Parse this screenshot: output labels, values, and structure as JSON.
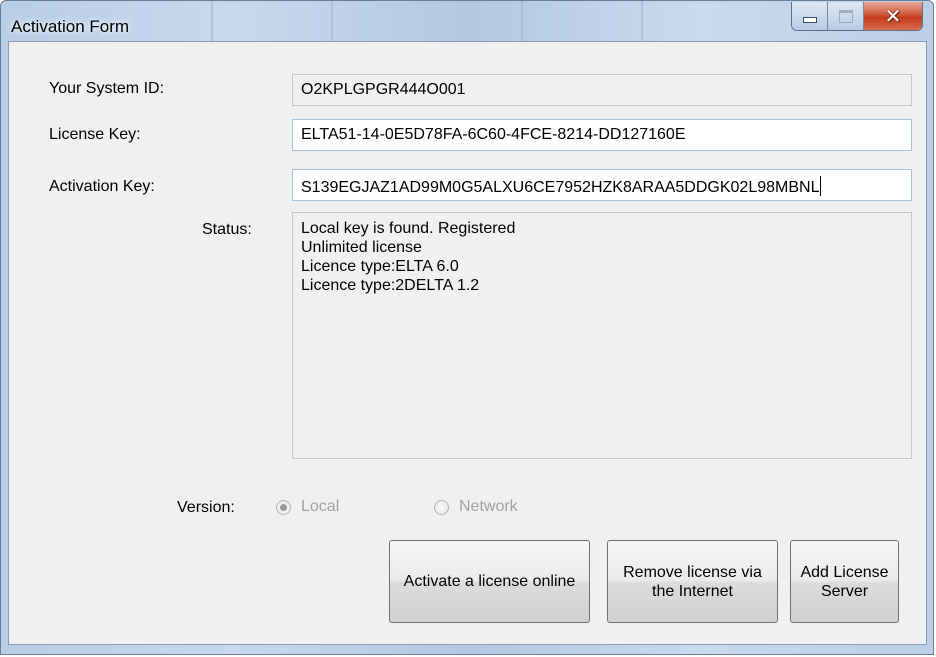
{
  "window": {
    "title": "Activation Form"
  },
  "form": {
    "system_id_label": "Your System ID:",
    "system_id_value": "O2KPLGPGR444O001",
    "license_key_label": "License Key:",
    "license_key_value": "ELTA51-14-0E5D78FA-6C60-4FCE-8214-DD127160E",
    "activation_key_label": "Activation Key:",
    "activation_key_value": "S139EGJAZ1AD99M0G5ALXU6CE7952HZK8ARAA5DDGK02L98MBNL",
    "status_label": "Status:",
    "status_lines": [
      "Local key is found. Registered",
      "Unlimited license",
      "Licence type:ELTA 6.0",
      "Licence type:2DELTA 1.2"
    ],
    "version_label": "Version:",
    "version_options": [
      "Local",
      "Network"
    ],
    "version_selected": "Local"
  },
  "buttons": {
    "activate_online": "Activate a license online",
    "remove_license": "Remove license via the Internet",
    "add_server": "Add License Server"
  },
  "colors": {
    "close_button": "#c8442a",
    "client_background": "#f0f0f0",
    "disabled_text": "#a2a2a2"
  }
}
